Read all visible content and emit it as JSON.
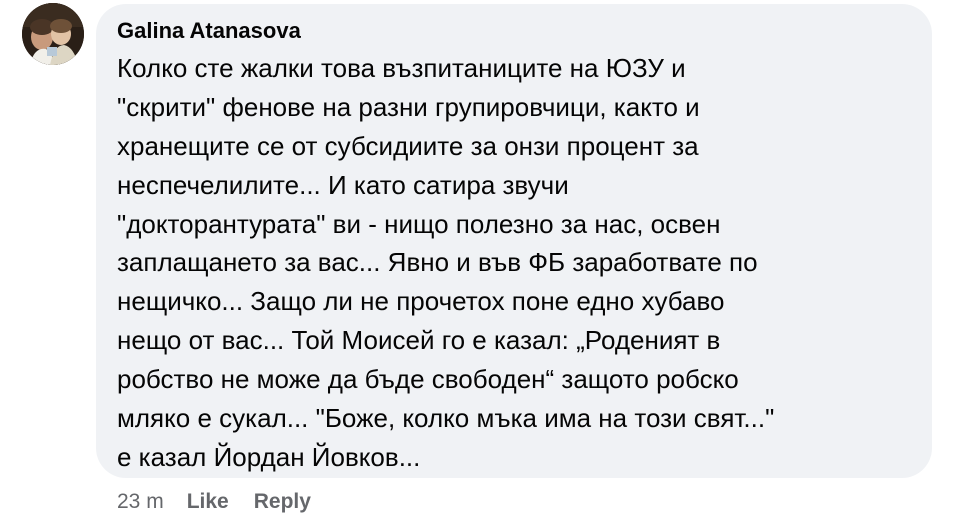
{
  "comment": {
    "author": "Galina Atanasova",
    "lines": [
      "Колко сте жалки това възпитаниците на ЮЗУ и",
      "\"скрити\" фенове на разни групировчици, както и",
      "хранещите се от субсидиите за онзи процент за",
      "неспечелилите... И като сатира звучи",
      "\"докторантурата\" ви - нищо полезно за нас, освен",
      "заплащането за вас... Явно и във ФБ заработвате по",
      "нещичко... Защо ли не прочетох поне едно хубаво",
      "нещо от вас... Той Моисей  го е казал: „Роденият в",
      "робство не може да бъде свободен“ защото робско",
      "мляко е сукал... \"Боже, колко мъка има на този свят...\"",
      "е казал Йордан Йовков..."
    ]
  },
  "meta": {
    "timestamp": "23 m",
    "like_label": "Like",
    "reply_label": "Reply"
  },
  "colors": {
    "bubble": "#f0f2f5",
    "text": "#050505",
    "secondary": "#65676b"
  },
  "icons": {
    "avatar": "profile-photo-avatar"
  }
}
